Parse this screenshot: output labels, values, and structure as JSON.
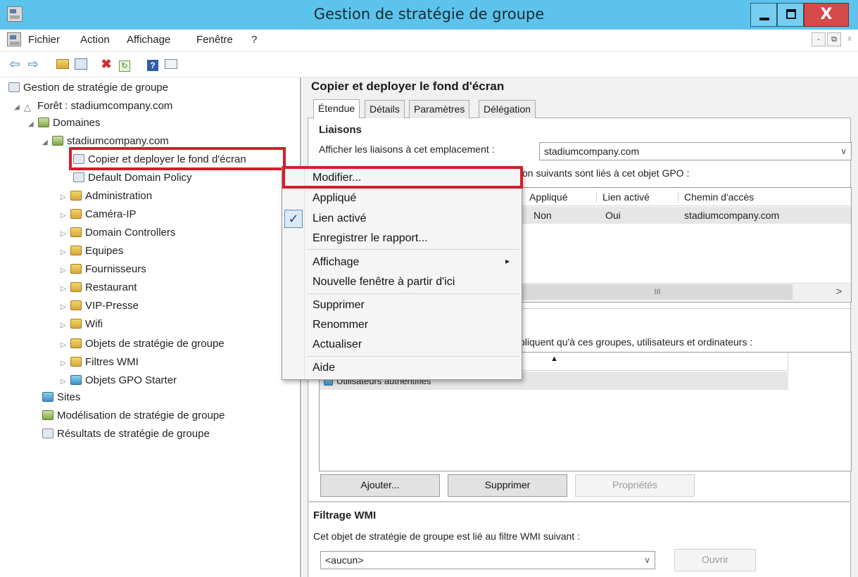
{
  "window": {
    "title": "Gestion de stratégie de groupe",
    "close_glyph": "X"
  },
  "menubar": {
    "items": [
      "Fichier",
      "Action",
      "Affichage",
      "Fenêtre",
      "?"
    ],
    "mdi_min": "-",
    "mdi_restore": "⧉",
    "mdi_close": "x"
  },
  "toolbar": {
    "icons": [
      "back-arrow-icon",
      "forward-arrow-icon",
      "up-folder-icon",
      "show-hide-tree-icon",
      "delete-icon",
      "refresh-icon",
      "help-icon",
      "properties-icon"
    ]
  },
  "tree": {
    "root": "Gestion de stratégie de groupe",
    "forest": "Forêt : stadiumcompany.com",
    "domains": "Domaines",
    "domain": "stadiumcompany.com",
    "gpo_selected": "Copier et deployer le fond d'écran",
    "gpo_default": "Default Domain Policy",
    "ous": [
      "Administration",
      "Caméra-IP",
      "Domain Controllers",
      "Equipes",
      "Fournisseurs",
      "Restaurant",
      "VIP-Presse",
      "Wifi"
    ],
    "gpo_objects": "Objets de stratégie de groupe",
    "wmi_filters": "Filtres WMI",
    "starter_gpo": "Objets GPO Starter",
    "sites": "Sites",
    "modeling": "Modélisation de stratégie de groupe",
    "results": "Résultats de stratégie de groupe"
  },
  "details": {
    "title": "Copier et deployer le fond d'écran",
    "tabs": [
      "Étendue",
      "Détails",
      "Paramètres",
      "Délégation"
    ],
    "links_heading": "Liaisons",
    "show_links_label": "Afficher les liaisons à cet emplacement :",
    "location_value": "stadiumcompany.com",
    "linked_text": "on suivants sont liés à cet objet GPO :",
    "columns": [
      "Appliqué",
      "Lien activé",
      "Chemin d'accès"
    ],
    "row": [
      "Non",
      "Oui",
      "stadiumcompany.com"
    ],
    "scroll_thumb": "III",
    "scroll_right": ">",
    "security_text": "pliquent qu'à ces groupes, utilisateurs et ordinateurs :",
    "security_item": "Utilisateurs authentifiés",
    "buttons": {
      "add": "Ajouter...",
      "remove": "Supprimer",
      "properties": "Propriétés"
    },
    "wmi_heading": "Filtrage WMI",
    "wmi_label": "Cet objet de stratégie de groupe est lié au filtre WMI suivant :",
    "wmi_value": "<aucun>",
    "open_button": "Ouvrir"
  },
  "context_menu": {
    "items": [
      "Modifier...",
      "Appliqué",
      "Lien activé",
      "Enregistrer le rapport...",
      "Affichage",
      "Nouvelle fenêtre à partir d'ici",
      "Supprimer",
      "Renommer",
      "Actualiser",
      "Aide"
    ],
    "checked": "Lien activé",
    "check_glyph": "✓",
    "submenu_glyph": "▸"
  },
  "colors": {
    "titlebar": "#5cc3ec",
    "highlight": "#d71d2a",
    "close": "#d64a4a"
  }
}
